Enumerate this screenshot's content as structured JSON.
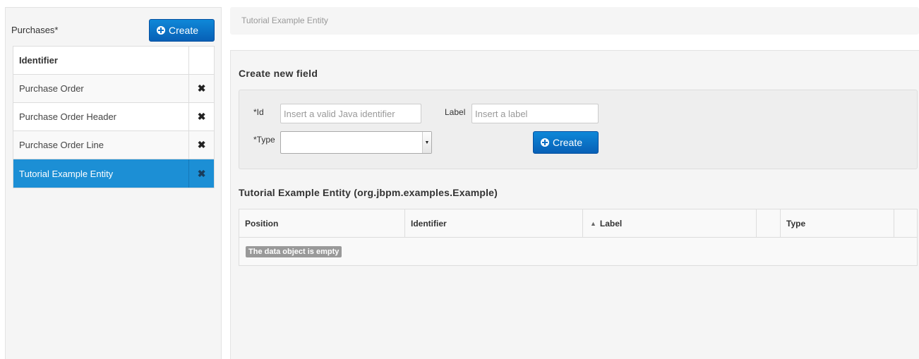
{
  "sidebar": {
    "title": "Purchases*",
    "create_label": "Create",
    "column_header": "Identifier",
    "items": [
      {
        "label": "Purchase Order"
      },
      {
        "label": "Purchase Order Header"
      },
      {
        "label": "Purchase Order Line"
      },
      {
        "label": "Tutorial Example Entity",
        "selected": true
      }
    ],
    "remove_icon": "✖"
  },
  "breadcrumb": {
    "text": "Tutorial Example Entity"
  },
  "new_field": {
    "title": "Create new field",
    "id_label": "*Id",
    "id_placeholder": "Insert a valid Java identifier",
    "label_label": "Label",
    "label_placeholder": "Insert a label",
    "type_label": "*Type",
    "type_value": "",
    "create_label": "Create"
  },
  "entity": {
    "title": "Tutorial Example Entity (org.jbpm.examples.Example)",
    "columns": {
      "position": "Position",
      "identifier": "Identifier",
      "label": "Label",
      "blank": "",
      "type": "Type"
    },
    "sort_indicator": "▲",
    "empty_message": "The data object is empty"
  },
  "colors": {
    "accent": "#0a6fc6",
    "selected_row": "#1c8fd5"
  }
}
